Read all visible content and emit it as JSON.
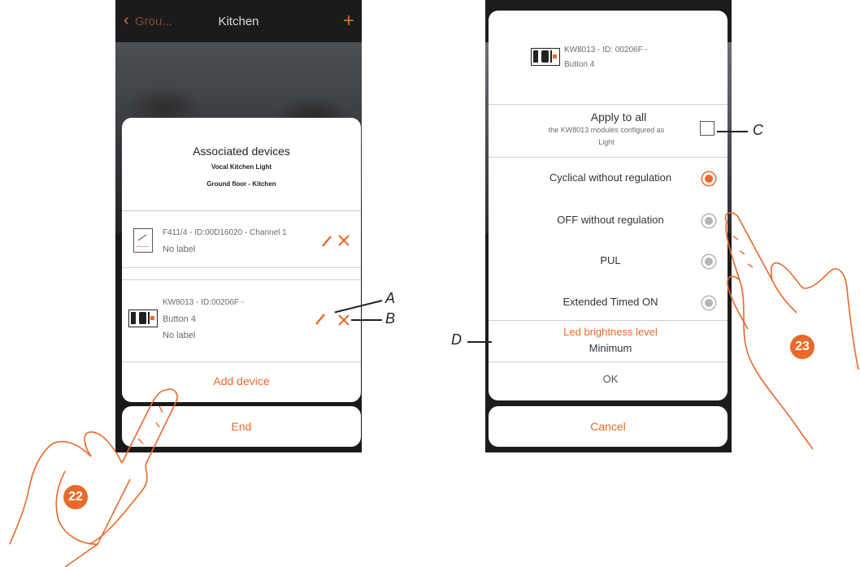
{
  "left_screen": {
    "topbar": {
      "back_label": "Grou...",
      "title": "Kitchen"
    },
    "dialog": {
      "title": "Associated devices",
      "subtitle1": "Vocal Kitchen Light",
      "subtitle2": "Ground floor - Kitchen",
      "devices": [
        {
          "name": "F411/4 - ID:00D16020 - Channel 1",
          "label": "No label"
        },
        {
          "name": "KW8013 - ID:00206F -",
          "name2": "Button 4",
          "label": "No label"
        }
      ],
      "add_device": "Add device"
    },
    "end_button": "End"
  },
  "right_screen": {
    "device_name": "KW8013 - ID: 00206F -",
    "device_name2": "Button 4",
    "apply_title": "Apply to all",
    "apply_line1": "the KW8013 modules configured as",
    "apply_line2": "Light",
    "options": [
      {
        "label": "Cyclical without regulation",
        "selected": true
      },
      {
        "label": "OFF without regulation",
        "selected": false
      },
      {
        "label": "PUL",
        "selected": false
      },
      {
        "label": "Extended Timed ON",
        "selected": false
      }
    ],
    "led_title": "Led brightness level",
    "led_value": "Minimum",
    "ok_button": "OK",
    "cancel_button": "Cancel"
  },
  "callouts": {
    "a": "A",
    "b": "B",
    "c": "C",
    "d": "D"
  },
  "steps": {
    "left": "22",
    "right": "23"
  },
  "colors": {
    "accent": "#e8692a",
    "topbar": "#1b1b1b"
  }
}
